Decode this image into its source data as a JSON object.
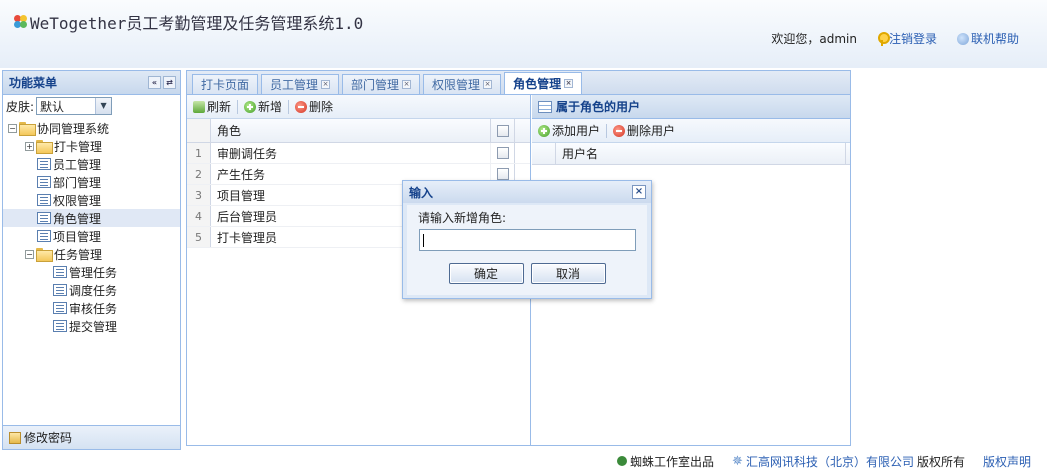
{
  "header": {
    "title": "WeTogether员工考勤管理及任务管理系统1.0",
    "welcome": "欢迎您，admin",
    "logout": "注销登录",
    "help": "联机帮助"
  },
  "sidebar": {
    "title": "功能菜单",
    "collapse_glyph": "«",
    "refresh_glyph": "⇄",
    "skin_label": "皮肤:",
    "skin_value": "默认",
    "tree": {
      "root": "协同管理系统",
      "group1": "打卡管理",
      "items1": [
        "员工管理",
        "部门管理",
        "权限管理",
        "角色管理",
        "项目管理"
      ],
      "group2": "任务管理",
      "items2": [
        "管理任务",
        "调度任务",
        "审核任务",
        "提交管理"
      ]
    },
    "footer": "修改密码"
  },
  "tabs": [
    {
      "label": "打卡页面"
    },
    {
      "label": "员工管理"
    },
    {
      "label": "部门管理"
    },
    {
      "label": "权限管理"
    },
    {
      "label": "角色管理"
    }
  ],
  "active_tab": 4,
  "role_panel": {
    "refresh": "刷新",
    "add": "新增",
    "delete": "删除",
    "column_role": "角色",
    "rows": [
      {
        "num": "1",
        "role": "审删调任务"
      },
      {
        "num": "2",
        "role": "产生任务"
      },
      {
        "num": "3",
        "role": "项目管理"
      },
      {
        "num": "4",
        "role": "后台管理员"
      },
      {
        "num": "5",
        "role": "打卡管理员"
      }
    ]
  },
  "user_panel": {
    "title": "属于角色的用户",
    "add_user": "添加用户",
    "delete_user": "删除用户",
    "column_username": "用户名"
  },
  "dialog": {
    "title": "输入",
    "close": "×",
    "prompt": "请输入新增角色:",
    "input_value": "",
    "ok": "确定",
    "cancel": "取消"
  },
  "footer": {
    "studio": "蜘蛛工作室出品",
    "company": "汇高网讯科技（北京）有限公司",
    "rights": "版权所有",
    "statement": "版权声明"
  }
}
